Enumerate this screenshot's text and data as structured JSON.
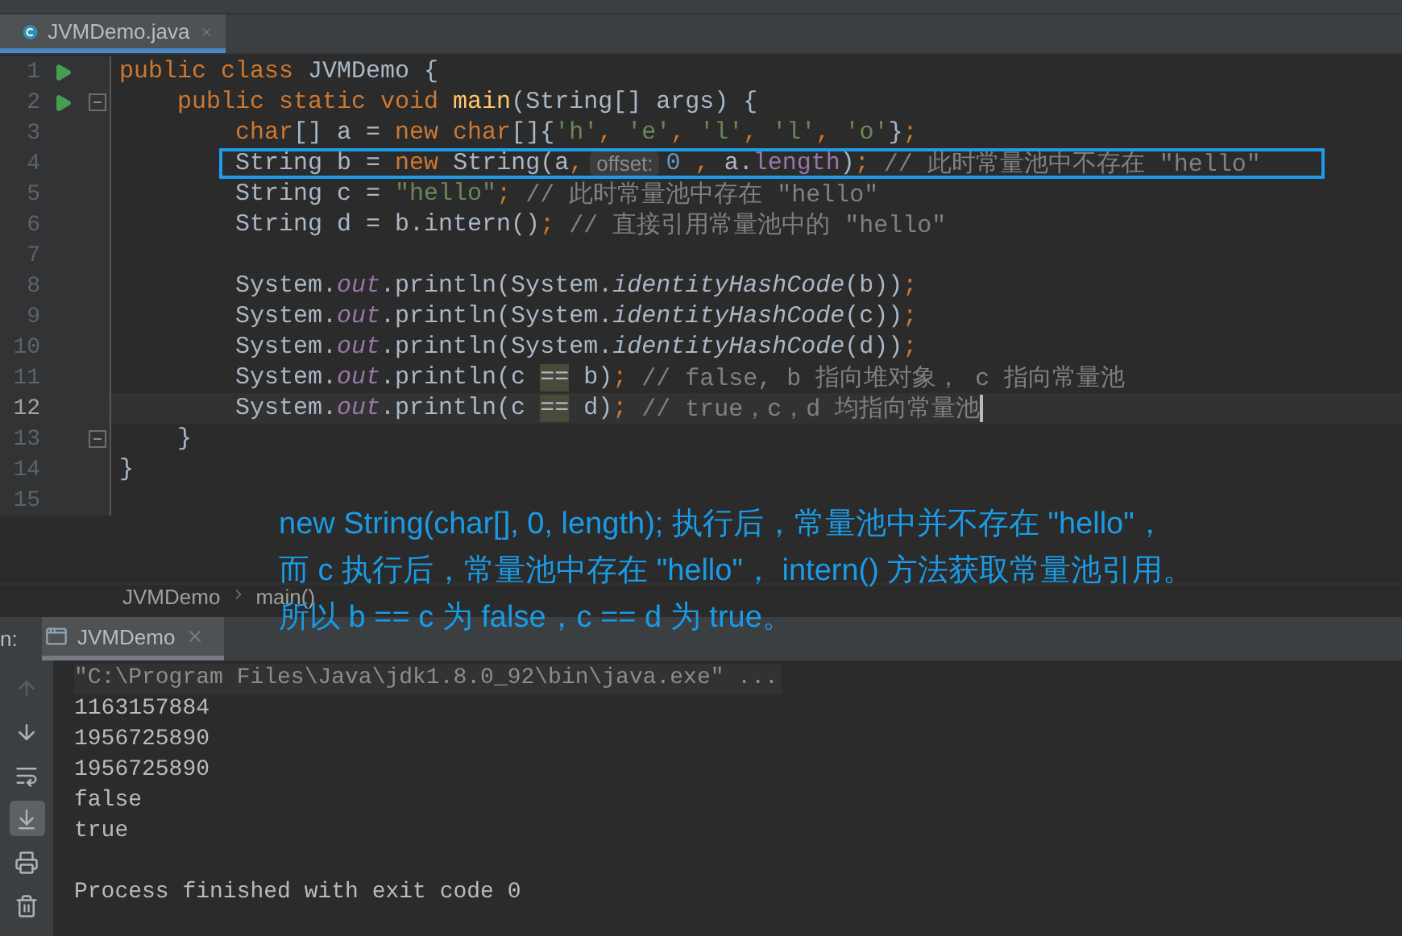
{
  "editor_tab": {
    "label": "JVMDemo.java",
    "selected": true
  },
  "code_lines": [
    {
      "number": "1",
      "run": true,
      "fold": false,
      "current": false,
      "boxed": false,
      "caret": false,
      "tokens": [
        {
          "kind": "keyword",
          "text": "public class "
        },
        {
          "kind": "plain",
          "text": "JVMDemo {"
        }
      ]
    },
    {
      "number": "2",
      "run": true,
      "fold": true,
      "current": false,
      "boxed": false,
      "caret": false,
      "tokens": [
        {
          "kind": "keyword",
          "text": "    public static void "
        },
        {
          "kind": "method",
          "text": "main"
        },
        {
          "kind": "plain",
          "text": "(String[] args) {"
        }
      ]
    },
    {
      "number": "3",
      "run": false,
      "fold": false,
      "current": false,
      "boxed": false,
      "caret": false,
      "tokens": [
        {
          "kind": "keyword",
          "text": "        char"
        },
        {
          "kind": "plain",
          "text": "[] a = "
        },
        {
          "kind": "keyword",
          "text": "new char"
        },
        {
          "kind": "plain",
          "text": "[]{"
        },
        {
          "kind": "string",
          "text": "'h'"
        },
        {
          "kind": "keyword",
          "text": ", "
        },
        {
          "kind": "string",
          "text": "'e'"
        },
        {
          "kind": "keyword",
          "text": ", "
        },
        {
          "kind": "string",
          "text": "'l'"
        },
        {
          "kind": "keyword",
          "text": ", "
        },
        {
          "kind": "string",
          "text": "'l'"
        },
        {
          "kind": "keyword",
          "text": ", "
        },
        {
          "kind": "string",
          "text": "'o'"
        },
        {
          "kind": "plain",
          "text": "}"
        },
        {
          "kind": "keyword",
          "text": ";"
        }
      ]
    },
    {
      "number": "4",
      "run": false,
      "fold": false,
      "current": false,
      "boxed": true,
      "caret": false,
      "tokens": [
        {
          "kind": "plain",
          "text": "        String b = "
        },
        {
          "kind": "keyword",
          "text": "new"
        },
        {
          "kind": "plain",
          "text": " String(a"
        },
        {
          "kind": "keyword",
          "text": ","
        },
        {
          "kind": "hint",
          "text": "offset:"
        },
        {
          "kind": "number",
          "text": "0"
        },
        {
          "kind": "keyword",
          "text": " ,"
        },
        {
          "kind": "plain",
          "text": " a."
        },
        {
          "kind": "member",
          "text": "length"
        },
        {
          "kind": "plain",
          "text": ")"
        },
        {
          "kind": "keyword",
          "text": ";"
        },
        {
          "kind": "comment",
          "text": " // 此时常量池中不存在 \"hello\""
        }
      ]
    },
    {
      "number": "5",
      "run": false,
      "fold": false,
      "current": false,
      "boxed": false,
      "caret": false,
      "tokens": [
        {
          "kind": "plain",
          "text": "        String c = "
        },
        {
          "kind": "string",
          "text": "\"hello\""
        },
        {
          "kind": "keyword",
          "text": ";"
        },
        {
          "kind": "comment",
          "text": " // 此时常量池中存在 \"hello\""
        }
      ]
    },
    {
      "number": "6",
      "run": false,
      "fold": false,
      "current": false,
      "boxed": false,
      "caret": false,
      "tokens": [
        {
          "kind": "plain",
          "text": "        String d = b.intern()"
        },
        {
          "kind": "keyword",
          "text": ";"
        },
        {
          "kind": "comment",
          "text": " // 直接引用常量池中的 \"hello\""
        }
      ]
    },
    {
      "number": "7",
      "run": false,
      "fold": false,
      "current": false,
      "boxed": false,
      "caret": false
    },
    {
      "number": "8",
      "run": false,
      "fold": false,
      "current": false,
      "boxed": false,
      "caret": false,
      "tokens": [
        {
          "kind": "plain",
          "text": "        System."
        },
        {
          "kind": "field",
          "text": "out"
        },
        {
          "kind": "plain",
          "text": ".println(System."
        },
        {
          "kind": "static",
          "text": "identityHashCode"
        },
        {
          "kind": "plain",
          "text": "(b))"
        },
        {
          "kind": "keyword",
          "text": ";"
        }
      ]
    },
    {
      "number": "9",
      "run": false,
      "fold": false,
      "current": false,
      "boxed": false,
      "caret": false,
      "tokens": [
        {
          "kind": "plain",
          "text": "        System."
        },
        {
          "kind": "field",
          "text": "out"
        },
        {
          "kind": "plain",
          "text": ".println(System."
        },
        {
          "kind": "static",
          "text": "identityHashCode"
        },
        {
          "kind": "plain",
          "text": "(c))"
        },
        {
          "kind": "keyword",
          "text": ";"
        }
      ]
    },
    {
      "number": "10",
      "run": false,
      "fold": false,
      "current": false,
      "boxed": false,
      "caret": false,
      "tokens": [
        {
          "kind": "plain",
          "text": "        System."
        },
        {
          "kind": "field",
          "text": "out"
        },
        {
          "kind": "plain",
          "text": ".println(System."
        },
        {
          "kind": "static",
          "text": "identityHashCode"
        },
        {
          "kind": "plain",
          "text": "(d))"
        },
        {
          "kind": "keyword",
          "text": ";"
        }
      ]
    },
    {
      "number": "11",
      "run": false,
      "fold": false,
      "current": false,
      "boxed": false,
      "caret": false,
      "tokens": [
        {
          "kind": "plain",
          "text": "        System."
        },
        {
          "kind": "field",
          "text": "out"
        },
        {
          "kind": "plain",
          "text": ".println(c "
        },
        {
          "kind": "match",
          "text": "=="
        },
        {
          "kind": "plain",
          "text": " b)"
        },
        {
          "kind": "keyword",
          "text": ";"
        },
        {
          "kind": "comment",
          "text": " // false, b 指向堆对象， c 指向常量池"
        }
      ]
    },
    {
      "number": "12",
      "run": false,
      "fold": false,
      "current": true,
      "boxed": false,
      "caret": true,
      "tokens": [
        {
          "kind": "plain",
          "text": "        System."
        },
        {
          "kind": "field",
          "text": "out"
        },
        {
          "kind": "plain",
          "text": ".println(c "
        },
        {
          "kind": "match",
          "text": "=="
        },
        {
          "kind": "plain",
          "text": " d)"
        },
        {
          "kind": "keyword",
          "text": ";"
        },
        {
          "kind": "comment",
          "text": " // true，c，d 均指向常量池"
        }
      ]
    },
    {
      "number": "13",
      "run": false,
      "fold": true,
      "current": false,
      "boxed": false,
      "caret": false,
      "tokens": [
        {
          "kind": "plain",
          "text": "    }"
        }
      ]
    },
    {
      "number": "14",
      "run": false,
      "fold": false,
      "current": false,
      "boxed": false,
      "caret": false,
      "tokens": [
        {
          "kind": "plain",
          "text": "}"
        }
      ]
    },
    {
      "number": "15",
      "run": false,
      "fold": false,
      "current": false,
      "boxed": false,
      "caret": false
    }
  ],
  "annotation": [
    "new String(char[], 0, length); 执行后，常量池中并不存在 \"hello\"，",
    "而 c 执行后，常量池中存在 \"hello\"， intern() 方法获取常量池引用。",
    "所以 b == c 为 false，c == d 为 true。"
  ],
  "breadcrumbs": [
    "JVMDemo",
    "main()"
  ],
  "run_panel": {
    "label": "n:",
    "tab": {
      "label": "JVMDemo",
      "selected": true
    },
    "toolbar": [
      {
        "kind": "up",
        "disabled": true,
        "selected": false
      },
      {
        "kind": "down",
        "disabled": false,
        "selected": false
      },
      {
        "kind": "wrap",
        "disabled": false,
        "selected": false
      },
      {
        "kind": "scroll",
        "disabled": false,
        "selected": true
      },
      {
        "kind": "print",
        "disabled": false,
        "selected": false
      },
      {
        "kind": "trash",
        "disabled": false,
        "selected": false
      }
    ],
    "command": "\"C:\\Program Files\\Java\\jdk1.8.0_92\\bin\\java.exe\" ...",
    "output": [
      "1163157884",
      "1956725890",
      "1956725890",
      "false",
      "true"
    ],
    "exit_message": "Process finished with exit code 0"
  }
}
